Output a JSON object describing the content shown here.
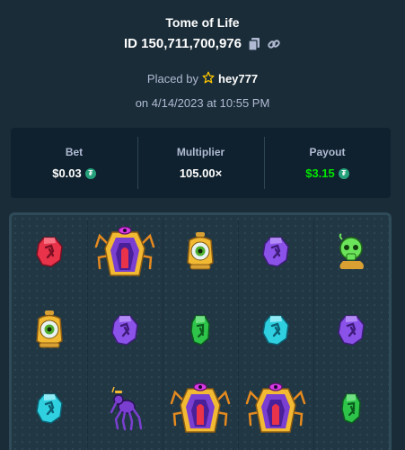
{
  "header": {
    "title": "Tome of Life",
    "bet_id": "ID 150,711,700,976",
    "copy_icon": "copy-icon",
    "link_icon": "link-icon"
  },
  "placed": {
    "prefix": "Placed by",
    "star_icon": "star-icon",
    "username": "hey777",
    "date": "on 4/14/2023 at 10:55 PM"
  },
  "stats": {
    "bet_label": "Bet",
    "bet_value": "$0.03",
    "multiplier_label": "Multiplier",
    "multiplier_value": "105.00×",
    "payout_label": "Payout",
    "payout_value": "$3.15",
    "currency_icon": "tether-coin-icon"
  },
  "colors": {
    "background": "#1a2c38",
    "panel": "#0f212e",
    "payout_green": "#00e701",
    "muted_text": "#b1bad3"
  },
  "reels": [
    [
      "red-rune-gem",
      "eye-lantern",
      "cyan-rune-gem"
    ],
    [
      "spider-queen-scatter",
      "purple-rune-gem",
      "purple-spider"
    ],
    [
      "eye-lantern",
      "green-rune-gem",
      "spider-queen-scatter"
    ],
    [
      "purple-rune-gem",
      "cyan-rune-gem",
      "spider-queen-scatter"
    ],
    [
      "green-skull-potion",
      "purple-rune-gem",
      "green-rune-gem"
    ]
  ]
}
